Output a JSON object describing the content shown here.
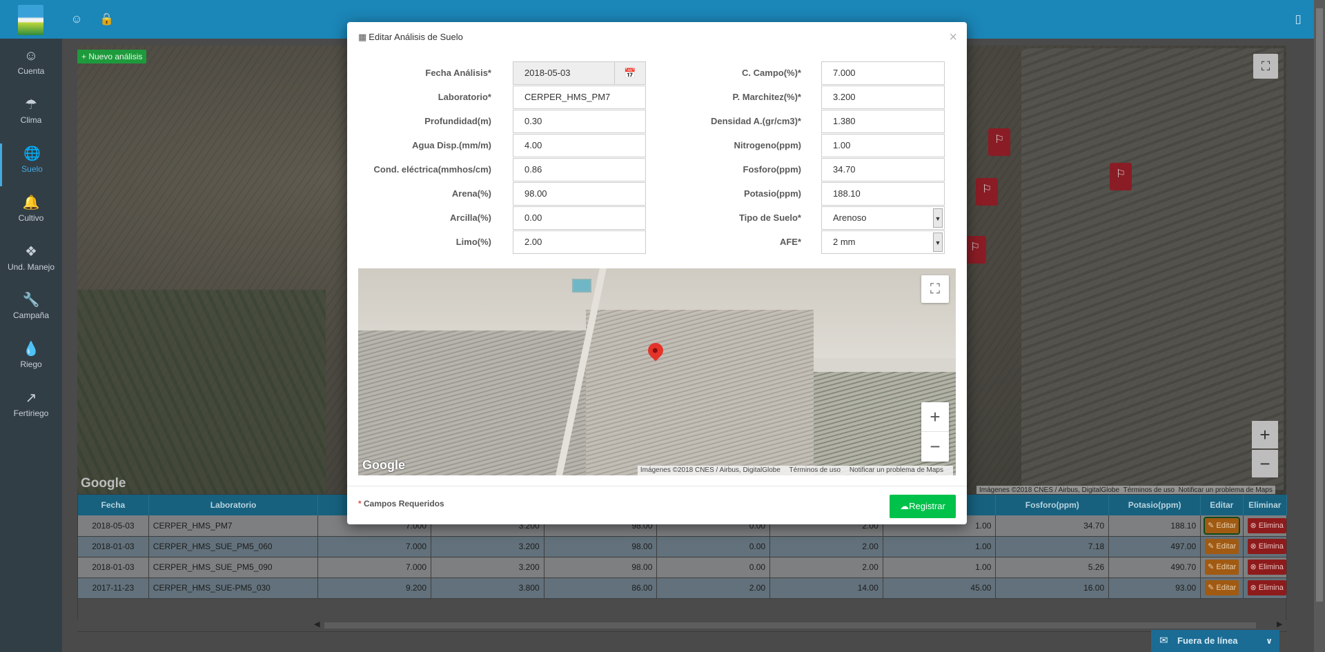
{
  "sidebar": {
    "items": [
      {
        "label": "Cuenta",
        "icon": "user-icon"
      },
      {
        "label": "Clima",
        "icon": "umbrella-icon"
      },
      {
        "label": "Suelo",
        "icon": "globe-icon"
      },
      {
        "label": "Cultivo",
        "icon": "bell-icon"
      },
      {
        "label": "Und. Manejo",
        "icon": "map-icon"
      },
      {
        "label": "Campaña",
        "icon": "wrench-icon"
      },
      {
        "label": "Riego",
        "icon": "drop-icon"
      },
      {
        "label": "Fertiriego",
        "icon": "trend-icon"
      }
    ],
    "active_index": 2
  },
  "toolbar": {
    "new_analysis_label": "+ Nuevo análisis"
  },
  "background_map": {
    "google_label": "Google",
    "attribution": "Imágenes ©2018 CNES / Airbus, DigitalGlobe",
    "terms": "Términos de uso",
    "report": "Notificar un problema de Maps"
  },
  "table": {
    "headers": [
      "Fecha",
      "Laboratorio",
      "",
      "",
      "",
      "",
      "",
      "",
      "Fosforo(ppm)",
      "Potasio(ppm)",
      "Editar",
      "Eliminar"
    ],
    "edit_label": "Editar",
    "delete_label": "Elimina",
    "rows": [
      {
        "fecha": "2018-05-03",
        "lab": "CERPER_HMS_PM7",
        "c1": "7.000",
        "c2": "3.200",
        "c3": "98.00",
        "c4": "0.00",
        "c5": "2.00",
        "c6": "1.00",
        "fosforo": "34.70",
        "potasio": "188.10"
      },
      {
        "fecha": "2018-01-03",
        "lab": "CERPER_HMS_SUE_PM5_060",
        "c1": "7.000",
        "c2": "3.200",
        "c3": "98.00",
        "c4": "0.00",
        "c5": "2.00",
        "c6": "1.00",
        "fosforo": "7.18",
        "potasio": "497.00"
      },
      {
        "fecha": "2018-01-03",
        "lab": "CERPER_HMS_SUE_PM5_090",
        "c1": "7.000",
        "c2": "3.200",
        "c3": "98.00",
        "c4": "0.00",
        "c5": "2.00",
        "c6": "1.00",
        "fosforo": "5.26",
        "potasio": "490.70"
      },
      {
        "fecha": "2017-11-23",
        "lab": "CERPER_HMS_SUE-PM5_030",
        "c1": "9.200",
        "c2": "3.800",
        "c3": "86.00",
        "c4": "2.00",
        "c5": "14.00",
        "c6": "45.00",
        "fosforo": "16.00",
        "potasio": "93.00"
      }
    ]
  },
  "offline_badge": "Fuera de línea",
  "modal": {
    "title": "Editar Análisis de Suelo",
    "left_fields": [
      {
        "label": "Fecha Análisis*",
        "value": "2018-05-03"
      },
      {
        "label": "Laboratorio*",
        "value": "CERPER_HMS_PM7"
      },
      {
        "label": "Profundidad(m)",
        "value": "0.30"
      },
      {
        "label": "Agua Disp.(mm/m)",
        "value": "4.00"
      },
      {
        "label": "Cond. eléctrica(mmhos/cm)",
        "value": "0.86"
      },
      {
        "label": "Arena(%)",
        "value": "98.00"
      },
      {
        "label": "Arcilla(%)",
        "value": "0.00"
      },
      {
        "label": "Limo(%)",
        "value": "2.00"
      }
    ],
    "right_fields": [
      {
        "label": "C. Campo(%)*",
        "value": "7.000"
      },
      {
        "label": "P. Marchitez(%)*",
        "value": "3.200"
      },
      {
        "label": "Densidad A.(gr/cm3)*",
        "value": "1.380"
      },
      {
        "label": "Nitrogeno(ppm)",
        "value": "1.00"
      },
      {
        "label": "Fosforo(ppm)",
        "value": "34.70"
      },
      {
        "label": "Potasio(ppm)",
        "value": "188.10"
      },
      {
        "label": "Tipo de Suelo*",
        "value": "Arenoso"
      },
      {
        "label": "AFE*",
        "value": "2 mm"
      }
    ],
    "map": {
      "google_label": "Google",
      "attribution": "Imágenes ©2018 CNES / Airbus, DigitalGlobe",
      "terms": "Términos de uso",
      "report": "Notificar un problema de Maps"
    },
    "required_note": "Campos Requeridos",
    "register_label": "Registrar"
  }
}
